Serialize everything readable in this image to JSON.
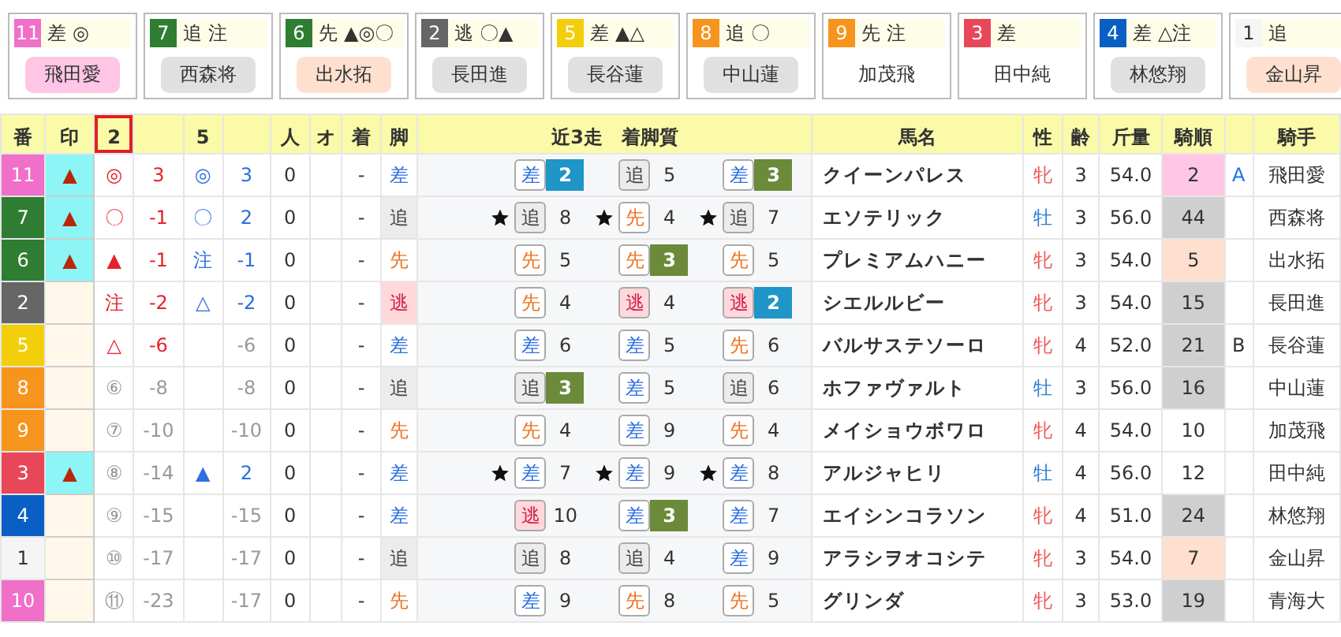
{
  "cards": [
    {
      "num": "11",
      "color": "#f06fc8",
      "leg": "差",
      "marks": "◎",
      "jockey": {
        "name": "飛田愛",
        "color": "#ffc6e6"
      }
    },
    {
      "num": "7",
      "color": "#2e7d32",
      "leg": "追",
      "marks": "注",
      "jockey": {
        "name": "西森将",
        "color": "#e0e0e0"
      }
    },
    {
      "num": "6",
      "color": "#2e7d32",
      "leg": "先",
      "marks": "▲◎〇",
      "jockey": {
        "name": "出水拓",
        "color": "#ffe0cf"
      }
    },
    {
      "num": "2",
      "color": "#666666",
      "leg": "逃",
      "marks": "〇▲",
      "jockey": {
        "name": "長田進",
        "color": "#e0e0e0"
      }
    },
    {
      "num": "5",
      "color": "#f2cf0a",
      "leg": "差",
      "marks": "▲△",
      "jockey": {
        "name": "長谷蓮",
        "color": "#e0e0e0"
      }
    },
    {
      "num": "8",
      "color": "#f7941d",
      "leg": "追",
      "marks": "〇",
      "jockey": {
        "name": "中山蓮",
        "color": "#e0e0e0"
      }
    },
    {
      "num": "9",
      "color": "#f7941d",
      "leg": "先",
      "marks": "注",
      "jockey": {
        "name": "加茂飛"
      }
    },
    {
      "num": "3",
      "color": "#e8475a",
      "leg": "差",
      "jockey": {
        "name": "田中純"
      }
    },
    {
      "num": "4",
      "color": "#0a5fc4",
      "leg": "差",
      "marks": "△注",
      "jockey": {
        "name": "林悠翔",
        "color": "#e0e0e0"
      }
    },
    {
      "num": "1",
      "color": "#f5f5f5",
      "leg": "追",
      "jockey": {
        "name": "金山昇",
        "color": "#ffe0cf"
      }
    }
  ],
  "columns": [
    {
      "label": "番",
      "selected": false
    },
    {
      "label": "印",
      "selected": false
    },
    {
      "label": "2",
      "selected": true
    },
    {
      "selected": false
    },
    {
      "label": "5",
      "selected": false
    },
    {
      "selected": false
    },
    {
      "label": "人",
      "selected": false
    },
    {
      "label": "オ",
      "selected": false
    },
    {
      "label": "着",
      "selected": false
    },
    {
      "label": "脚",
      "selected": false
    },
    {
      "label": "近3走　着脚質",
      "selected": false
    },
    {
      "label": "馬名",
      "selected": false
    },
    {
      "label": "性",
      "selected": false
    },
    {
      "label": "齢",
      "selected": false
    },
    {
      "label": "斤量",
      "selected": false
    },
    {
      "label": "騎順",
      "selected": false
    },
    {
      "selected": false
    },
    {
      "label": "騎手",
      "selected": false
    }
  ],
  "rows": [
    {
      "num": "11",
      "color": "#f06fc8",
      "mark": "▲",
      "m2": "◎",
      "s2": "3",
      "top": true,
      "m5": "◎",
      "s5": "3",
      "pop": "0",
      "fin": "-",
      "leg": {
        "label": "差",
        "kind": "sashi"
      },
      "runs": [
        {
          "star": false,
          "leg": {
            "label": "差",
            "kind": "sashi"
          },
          "place": "2",
          "kind": "second"
        },
        {
          "star": false,
          "leg": {
            "label": "追",
            "kind": "oikomi"
          },
          "place": "5",
          "kind": "plain"
        },
        {
          "star": false,
          "leg": {
            "label": "差",
            "kind": "sashi"
          },
          "place": "3",
          "kind": "third"
        }
      ],
      "name": "クイーンパレス",
      "sex": {
        "label": "牝",
        "kind": "female"
      },
      "age": "3",
      "weight": "54.0",
      "order": {
        "value": "2",
        "color": "#ffc6e6"
      },
      "grade": {
        "label": "A",
        "color": "#1a73e8"
      },
      "jockey": "飛田愛"
    },
    {
      "num": "7",
      "color": "#2e7d32",
      "mark": "▲",
      "m2": "〇",
      "s2": "-1",
      "top": true,
      "m5": "〇",
      "s5": "2",
      "pop": "0",
      "fin": "-",
      "leg": {
        "label": "追",
        "kind": "oikomi"
      },
      "runs": [
        {
          "star": true,
          "leg": {
            "label": "追",
            "kind": "oikomi"
          },
          "place": "8",
          "kind": "plain"
        },
        {
          "star": true,
          "leg": {
            "label": "先",
            "kind": "senko"
          },
          "place": "4",
          "kind": "plain"
        },
        {
          "star": true,
          "leg": {
            "label": "追",
            "kind": "oikomi"
          },
          "place": "7",
          "kind": "plain"
        }
      ],
      "name": "エソテリック",
      "sex": {
        "label": "牡",
        "kind": "male"
      },
      "age": "3",
      "weight": "56.0",
      "order": {
        "value": "44",
        "color": "#cfcfcf"
      },
      "jockey": "西森将"
    },
    {
      "num": "6",
      "color": "#2e7d32",
      "mark": "▲",
      "m2": "▲",
      "s2": "-1",
      "top": true,
      "m5": "注",
      "s5": "-1",
      "pop": "0",
      "fin": "-",
      "leg": {
        "label": "先",
        "kind": "senko"
      },
      "runs": [
        {
          "star": false,
          "leg": {
            "label": "先",
            "kind": "senko"
          },
          "place": "5",
          "kind": "plain"
        },
        {
          "star": false,
          "leg": {
            "label": "先",
            "kind": "senko"
          },
          "place": "3",
          "kind": "third"
        },
        {
          "star": false,
          "leg": {
            "label": "先",
            "kind": "senko"
          },
          "place": "5",
          "kind": "plain"
        }
      ],
      "name": "プレミアムハニー",
      "sex": {
        "label": "牝",
        "kind": "female"
      },
      "age": "3",
      "weight": "54.0",
      "order": {
        "value": "5",
        "color": "#ffe0cf"
      },
      "jockey": "出水拓"
    },
    {
      "num": "2",
      "color": "#666666",
      "m2": "注",
      "s2": "-2",
      "top": true,
      "m5": "△",
      "s5": "-2",
      "pop": "0",
      "fin": "-",
      "leg": {
        "label": "逃",
        "kind": "nige"
      },
      "runs": [
        {
          "star": false,
          "leg": {
            "label": "先",
            "kind": "senko"
          },
          "place": "4",
          "kind": "plain"
        },
        {
          "star": false,
          "leg": {
            "label": "逃",
            "kind": "nige"
          },
          "place": "4",
          "kind": "plain"
        },
        {
          "star": false,
          "leg": {
            "label": "逃",
            "kind": "nige"
          },
          "place": "2",
          "kind": "second"
        }
      ],
      "name": "シエルルビー",
      "sex": {
        "label": "牝",
        "kind": "female"
      },
      "age": "3",
      "weight": "54.0",
      "order": {
        "value": "15",
        "color": "#cfcfcf"
      },
      "jockey": "長田進"
    },
    {
      "num": "5",
      "color": "#f2cf0a",
      "m2": "△",
      "s2": "-6",
      "top": true,
      "s5": "-6",
      "pop": "0",
      "fin": "-",
      "leg": {
        "label": "差",
        "kind": "sashi"
      },
      "runs": [
        {
          "star": false,
          "leg": {
            "label": "差",
            "kind": "sashi"
          },
          "place": "6",
          "kind": "plain"
        },
        {
          "star": false,
          "leg": {
            "label": "差",
            "kind": "sashi"
          },
          "place": "5",
          "kind": "plain"
        },
        {
          "star": false,
          "leg": {
            "label": "先",
            "kind": "senko"
          },
          "place": "6",
          "kind": "plain"
        }
      ],
      "name": "バルサステソーロ",
      "sex": {
        "label": "牝",
        "kind": "female"
      },
      "age": "4",
      "weight": "52.0",
      "order": {
        "value": "21",
        "color": "#cfcfcf"
      },
      "grade": {
        "label": "B",
        "color": "#333333"
      },
      "jockey": "長谷蓮"
    },
    {
      "num": "8",
      "color": "#f7941d",
      "m2": "⑥",
      "s2": "-8",
      "top": false,
      "s5": "-8",
      "pop": "0",
      "fin": "-",
      "leg": {
        "label": "追",
        "kind": "oikomi"
      },
      "runs": [
        {
          "star": false,
          "leg": {
            "label": "追",
            "kind": "oikomi"
          },
          "place": "3",
          "kind": "third"
        },
        {
          "star": false,
          "leg": {
            "label": "差",
            "kind": "sashi"
          },
          "place": "5",
          "kind": "plain"
        },
        {
          "star": false,
          "leg": {
            "label": "追",
            "kind": "oikomi"
          },
          "place": "6",
          "kind": "plain"
        }
      ],
      "name": "ホファヴァルト",
      "sex": {
        "label": "牡",
        "kind": "male"
      },
      "age": "3",
      "weight": "56.0",
      "order": {
        "value": "16",
        "color": "#cfcfcf"
      },
      "jockey": "中山蓮"
    },
    {
      "num": "9",
      "color": "#f7941d",
      "m2": "⑦",
      "s2": "-10",
      "top": false,
      "s5": "-10",
      "pop": "0",
      "fin": "-",
      "leg": {
        "label": "先",
        "kind": "senko"
      },
      "runs": [
        {
          "star": false,
          "leg": {
            "label": "先",
            "kind": "senko"
          },
          "place": "4",
          "kind": "plain"
        },
        {
          "star": false,
          "leg": {
            "label": "差",
            "kind": "sashi"
          },
          "place": "9",
          "kind": "plain"
        },
        {
          "star": false,
          "leg": {
            "label": "先",
            "kind": "senko"
          },
          "place": "4",
          "kind": "plain"
        }
      ],
      "name": "メイショウボワロ",
      "sex": {
        "label": "牝",
        "kind": "female"
      },
      "age": "4",
      "weight": "54.0",
      "order": {
        "value": "10"
      },
      "jockey": "加茂飛"
    },
    {
      "num": "3",
      "color": "#e8475a",
      "mark": "▲",
      "m2": "⑧",
      "s2": "-14",
      "top": false,
      "m5": "▲",
      "s5": "2",
      "pop": "0",
      "fin": "-",
      "leg": {
        "label": "差",
        "kind": "sashi"
      },
      "runs": [
        {
          "star": true,
          "leg": {
            "label": "差",
            "kind": "sashi"
          },
          "place": "7",
          "kind": "plain"
        },
        {
          "star": true,
          "leg": {
            "label": "差",
            "kind": "sashi"
          },
          "place": "9",
          "kind": "plain"
        },
        {
          "star": true,
          "leg": {
            "label": "差",
            "kind": "sashi"
          },
          "place": "8",
          "kind": "plain"
        }
      ],
      "name": "アルジャヒリ",
      "sex": {
        "label": "牡",
        "kind": "male"
      },
      "age": "4",
      "weight": "56.0",
      "order": {
        "value": "12"
      },
      "jockey": "田中純"
    },
    {
      "num": "4",
      "color": "#0a5fc4",
      "m2": "⑨",
      "s2": "-15",
      "top": false,
      "s5": "-15",
      "pop": "0",
      "fin": "-",
      "leg": {
        "label": "差",
        "kind": "sashi"
      },
      "runs": [
        {
          "star": false,
          "leg": {
            "label": "逃",
            "kind": "nige"
          },
          "place": "10",
          "kind": "plain"
        },
        {
          "star": false,
          "leg": {
            "label": "差",
            "kind": "sashi"
          },
          "place": "3",
          "kind": "third"
        },
        {
          "star": false,
          "leg": {
            "label": "差",
            "kind": "sashi"
          },
          "place": "7",
          "kind": "plain"
        }
      ],
      "name": "エイシンコラソン",
      "sex": {
        "label": "牝",
        "kind": "female"
      },
      "age": "4",
      "weight": "51.0",
      "order": {
        "value": "24",
        "color": "#cfcfcf"
      },
      "jockey": "林悠翔"
    },
    {
      "num": "1",
      "color": "#f5f5f5",
      "m2": "⑩",
      "s2": "-17",
      "top": false,
      "s5": "-17",
      "pop": "0",
      "fin": "-",
      "leg": {
        "label": "追",
        "kind": "oikomi"
      },
      "runs": [
        {
          "star": false,
          "leg": {
            "label": "追",
            "kind": "oikomi"
          },
          "place": "8",
          "kind": "plain"
        },
        {
          "star": false,
          "leg": {
            "label": "追",
            "kind": "oikomi"
          },
          "place": "4",
          "kind": "plain"
        },
        {
          "star": false,
          "leg": {
            "label": "差",
            "kind": "sashi"
          },
          "place": "9",
          "kind": "plain"
        }
      ],
      "name": "アラシヲオコシテ",
      "sex": {
        "label": "牝",
        "kind": "female"
      },
      "age": "3",
      "weight": "54.0",
      "order": {
        "value": "7",
        "color": "#ffe0cf"
      },
      "jockey": "金山昇"
    },
    {
      "num": "10",
      "color": "#f06fc8",
      "m2": "⑪",
      "s2": "-23",
      "top": false,
      "s5": "-17",
      "pop": "0",
      "fin": "-",
      "leg": {
        "label": "先",
        "kind": "senko"
      },
      "runs": [
        {
          "star": false,
          "leg": {
            "label": "差",
            "kind": "sashi"
          },
          "place": "9",
          "kind": "plain"
        },
        {
          "star": false,
          "leg": {
            "label": "先",
            "kind": "senko"
          },
          "place": "8",
          "kind": "plain"
        },
        {
          "star": false,
          "leg": {
            "label": "先",
            "kind": "senko"
          },
          "place": "5",
          "kind": "plain"
        }
      ],
      "name": "グリンダ",
      "sex": {
        "label": "牝",
        "kind": "female"
      },
      "age": "3",
      "weight": "53.0",
      "order": {
        "value": "19",
        "color": "#cfcfcf"
      },
      "jockey": "青海大"
    }
  ]
}
